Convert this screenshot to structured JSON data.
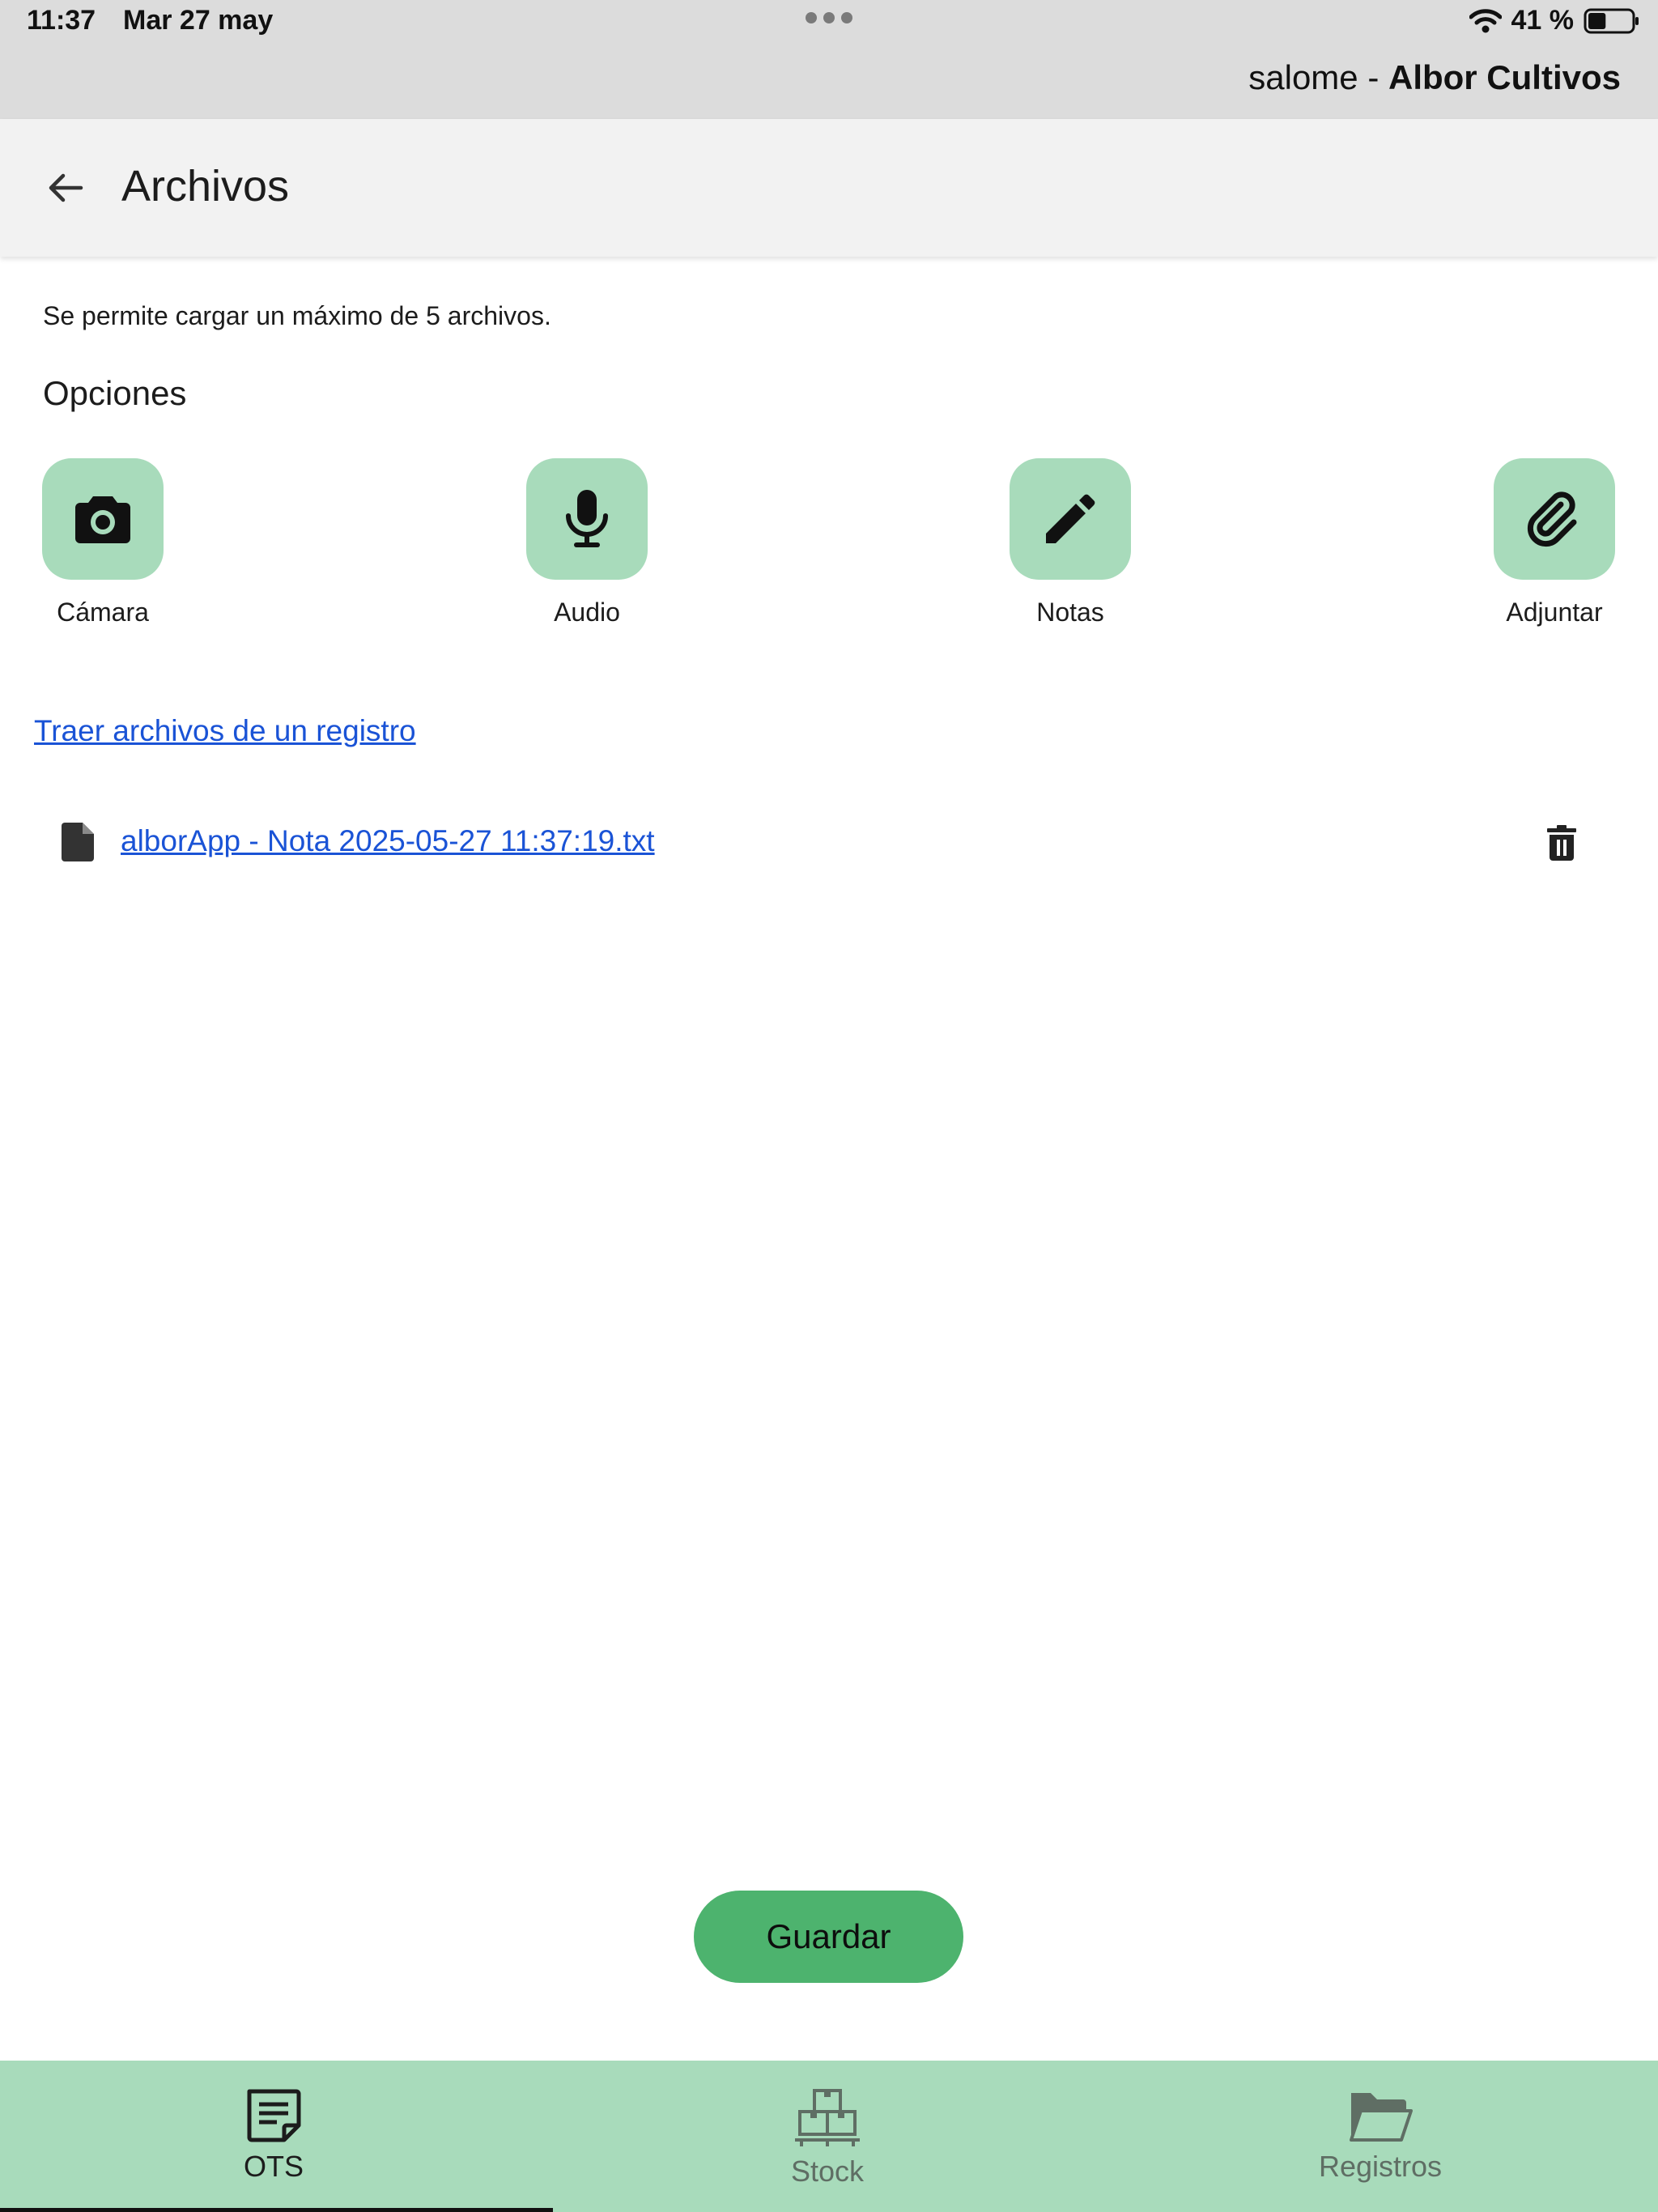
{
  "status_bar": {
    "time": "11:37",
    "date": "Mar 27 may",
    "battery_pct": "41 %",
    "battery_level": 0.41
  },
  "session": {
    "user": "salome",
    "separator": " - ",
    "company": "Albor Cultivos"
  },
  "appbar": {
    "title": "Archivos"
  },
  "content": {
    "info_text": "Se permite cargar un máximo de 5 archivos.",
    "options_title": "Opciones",
    "options": [
      {
        "label": "Cámara",
        "icon": "camera-icon"
      },
      {
        "label": "Audio",
        "icon": "microphone-icon"
      },
      {
        "label": "Notas",
        "icon": "pencil-icon"
      },
      {
        "label": "Adjuntar",
        "icon": "paperclip-icon"
      }
    ],
    "records_link": "Traer archivos de un registro",
    "files": [
      {
        "name": "alborApp - Nota 2025-05-27 11:37:19.txt",
        "icon": "file-icon"
      }
    ],
    "save_label": "Guardar"
  },
  "bottom_nav": {
    "items": [
      {
        "label": "OTS",
        "icon": "document-icon",
        "active": true
      },
      {
        "label": "Stock",
        "icon": "boxes-icon",
        "active": false
      },
      {
        "label": "Registros",
        "icon": "folder-icon",
        "active": false
      }
    ]
  },
  "colors": {
    "accent": "#a8dbbb",
    "primary_button": "#4db36e",
    "link": "#1a53d6",
    "status_bar_bg": "#dcdcdc",
    "appbar_bg": "#f2f2f2"
  }
}
